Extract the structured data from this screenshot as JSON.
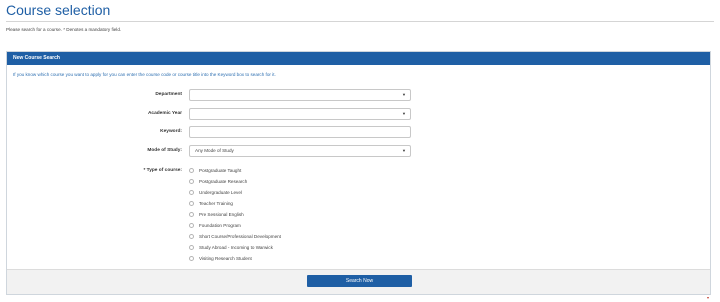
{
  "page": {
    "title": "Course selection",
    "intro": "Please search for a course. * Denotes a mandatory field."
  },
  "panel": {
    "header": "New Course Search",
    "hint": "If you know which course you want to apply for you can enter the course code or course title into the Keyword box to search for it."
  },
  "form": {
    "department_label": "Department",
    "department_value": "",
    "academic_year_label": "Academic Year",
    "academic_year_value": "",
    "keyword_label": "Keyword:",
    "keyword_value": "",
    "mode_label": "Mode of Study:",
    "mode_value": "Any Mode of Study",
    "type_label": "* Type of course:",
    "course_types": [
      "Postgraduate Taught",
      "Postgraduate Research",
      "Undergraduate Level",
      "Teacher Training",
      "Pre Sessional English",
      "Foundation Program",
      "Short Course/Professional Development",
      "Study Abroad - Incoming to Warwick",
      "Visiting Research Student"
    ]
  },
  "footer": {
    "search_label": "Search Now"
  },
  "icons": {
    "dropdown": "caret-down-icon",
    "radio": "radio-button-icon"
  },
  "colors": {
    "brand": "#1f5fa5",
    "hint": "#2d6fb1"
  }
}
